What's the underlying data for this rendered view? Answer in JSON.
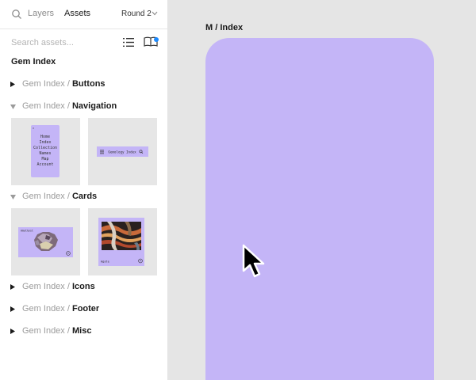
{
  "header": {
    "tabs": [
      {
        "label": "Layers"
      },
      {
        "label": "Assets"
      }
    ],
    "page_selector": "Round 2"
  },
  "search": {
    "placeholder": "Search assets..."
  },
  "library": {
    "title": "Gem Index",
    "groups": [
      {
        "prefix": "Gem Index / ",
        "name": "Buttons",
        "expanded": false
      },
      {
        "prefix": "Gem Index / ",
        "name": "Navigation",
        "expanded": true
      },
      {
        "prefix": "Gem Index / ",
        "name": "Cards",
        "expanded": true
      },
      {
        "prefix": "Gem Index / ",
        "name": "Icons",
        "expanded": false
      },
      {
        "prefix": "Gem Index / ",
        "name": "Footer",
        "expanded": false
      },
      {
        "prefix": "Gem Index / ",
        "name": "Misc",
        "expanded": false
      }
    ],
    "nav_thumbs": {
      "menu_items": [
        "Home",
        "Index",
        "Collection",
        "Names",
        "Map",
        "Account"
      ],
      "bar_title": "Gemology Index"
    },
    "card_thumbs": {
      "card1_label": "Amethyst",
      "card2_label": "Agate"
    }
  },
  "canvas": {
    "frame_label": "M / Index",
    "frame_color": "#c4b5f7"
  },
  "colors": {
    "accent_purple": "#c4b5f7",
    "notification_blue": "#1e8cff"
  }
}
